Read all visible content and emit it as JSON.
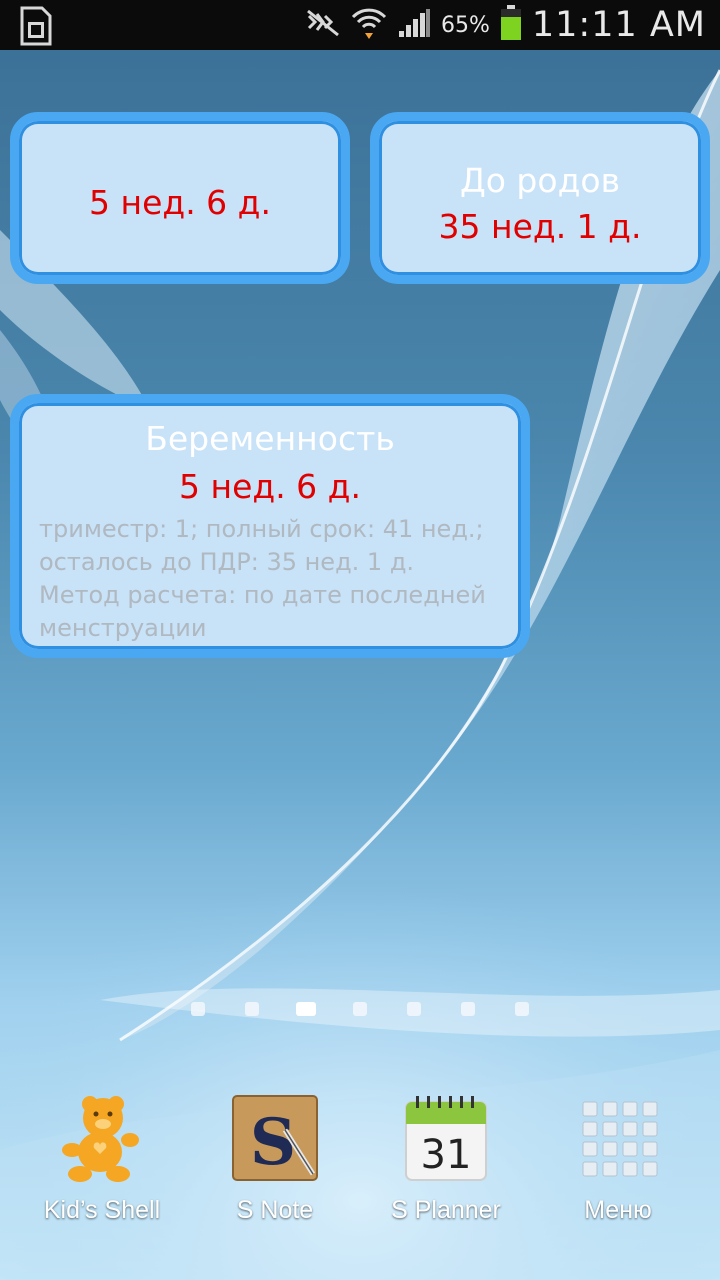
{
  "status_bar": {
    "battery_percent": "65%",
    "time": "11:11 AM",
    "icons": [
      "sim-card-icon",
      "silent-icon",
      "wifi-icon",
      "signal-icon",
      "battery-icon"
    ]
  },
  "widget_left": {
    "value": "5 нед. 6 д."
  },
  "widget_right": {
    "title": "До родов",
    "value": "35 нед. 1 д."
  },
  "widget_main": {
    "title": "Беременность",
    "value": "5 нед. 6 д.",
    "details": "триместр: 1; полный срок: 41 нед.; осталось до ПДР: 35 нед. 1 д.",
    "method": "Метод расчета: по дате последней менструации"
  },
  "page_indicator": {
    "count": 7,
    "active_index": 2
  },
  "dock": [
    {
      "label": "Kid’s Shell",
      "icon": "teddy-bear-icon"
    },
    {
      "label": "S Note",
      "icon": "s-note-icon"
    },
    {
      "label": "S Planner",
      "icon": "calendar-icon",
      "icon_text": "31"
    },
    {
      "label": "Меню",
      "icon": "app-grid-icon"
    }
  ]
}
